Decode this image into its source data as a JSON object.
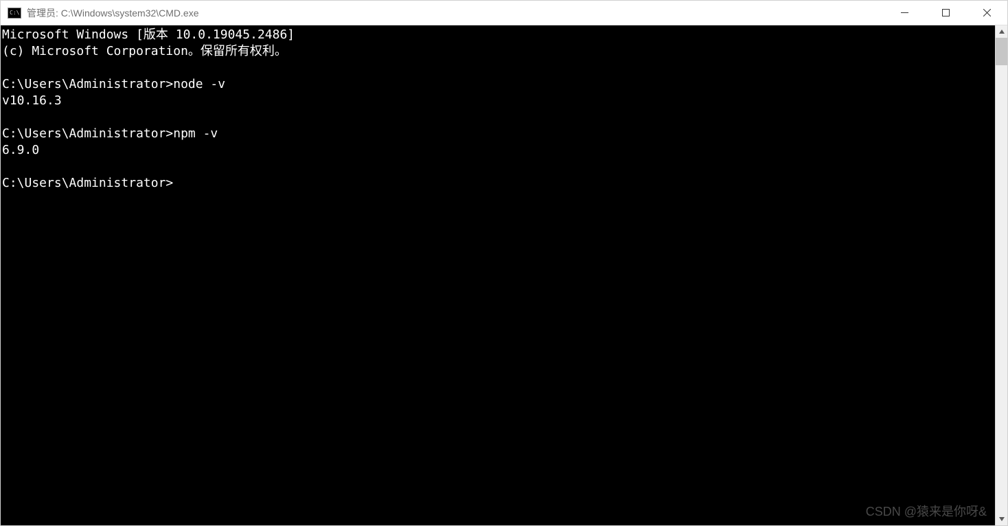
{
  "window": {
    "title": "管理员: C:\\Windows\\system32\\CMD.exe",
    "icon_label": "C:\\"
  },
  "terminal": {
    "header_line1": "Microsoft Windows [版本 10.0.19045.2486]",
    "header_line2": "(c) Microsoft Corporation。保留所有权利。",
    "entries": [
      {
        "prompt": "C:\\Users\\Administrator>",
        "command": "node -v",
        "output": "v10.16.3"
      },
      {
        "prompt": "C:\\Users\\Administrator>",
        "command": "npm -v",
        "output": "6.9.0"
      }
    ],
    "current_prompt": "C:\\Users\\Administrator>"
  },
  "watermark": "CSDN @猿来是你呀&"
}
